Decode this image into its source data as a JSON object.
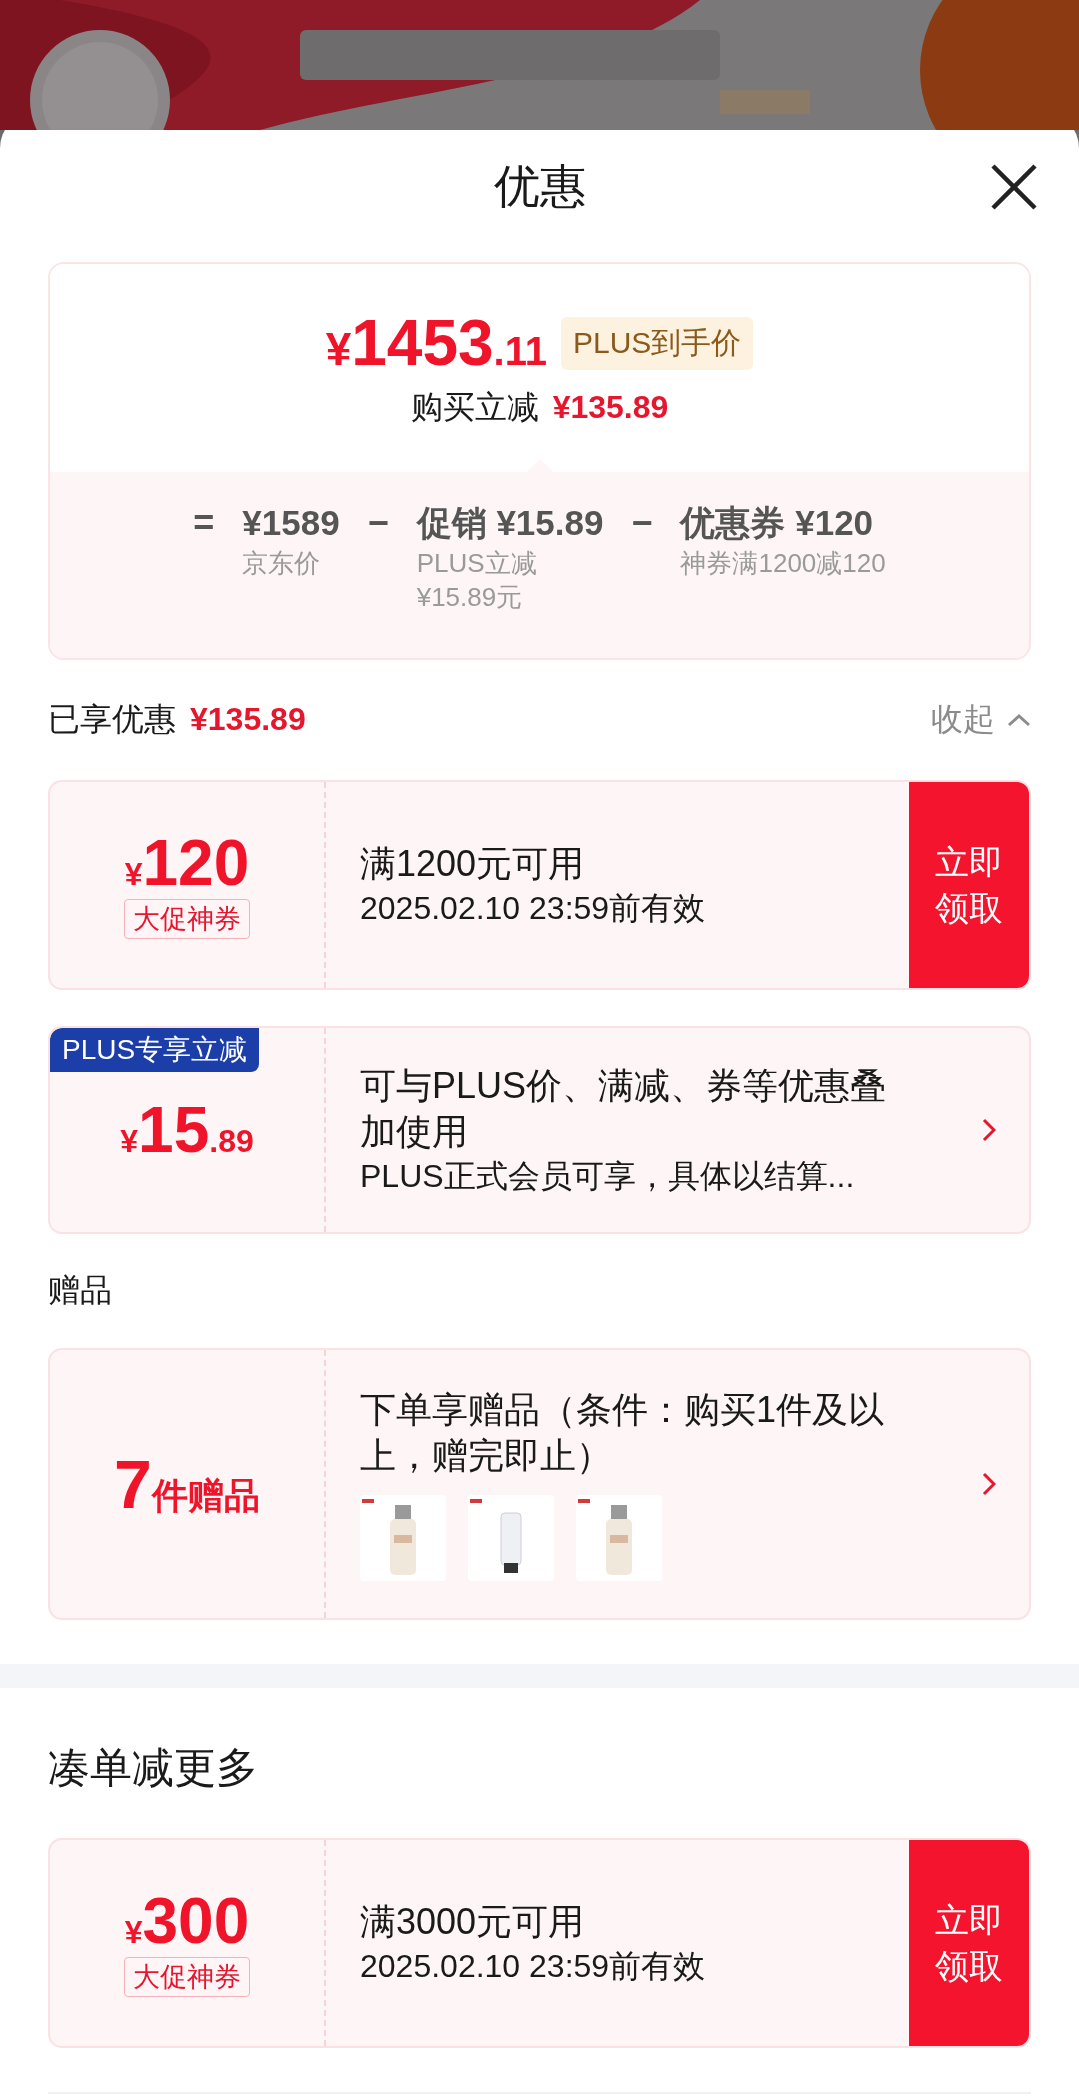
{
  "sheet": {
    "title": "优惠"
  },
  "summary": {
    "price_currency": "¥",
    "price_main": "1453",
    "price_fraction": ".11",
    "price_badge": "PLUS到手价",
    "instant_label": "购买立减",
    "instant_amount": "¥135.89",
    "breakdown": [
      {
        "kind": "operator",
        "text": "="
      },
      {
        "kind": "term",
        "value": "¥1589",
        "note": "京东价"
      },
      {
        "kind": "operator",
        "text": "−"
      },
      {
        "kind": "term",
        "value": "促销 ¥15.89",
        "note": "PLUS立减 ¥15.89元"
      },
      {
        "kind": "operator",
        "text": "−"
      },
      {
        "kind": "term",
        "value": "优惠券 ¥120",
        "note": "神券满1200减120"
      }
    ]
  },
  "enjoyed": {
    "label": "已享优惠",
    "amount": "¥135.89",
    "toggle": "收起"
  },
  "offers": [
    {
      "kind": "coupon",
      "currency": "¥",
      "amount": "120",
      "tag": "大促神券",
      "title": "满1200元可用",
      "subtitle": "2025.02.10 23:59前有效",
      "button": "立即领取"
    },
    {
      "kind": "plus",
      "badge": "PLUS专享立减",
      "currency": "¥",
      "amount": "15",
      "fraction": ".89",
      "title": "可与PLUS价、满减、券等优惠叠加使用",
      "subtitle": "PLUS正式会员可享，具体以结算..."
    }
  ],
  "gifts_label": "赠品",
  "gifts": {
    "count": "7",
    "count_label": "件赠品",
    "title": "下单享赠品（条件：购买1件及以上，赠完即止）"
  },
  "more_section": {
    "title": "凑单减更多",
    "offers": [
      {
        "kind": "coupon",
        "currency": "¥",
        "amount": "300",
        "tag": "大促神券",
        "title": "满3000元可用",
        "subtitle": "2025.02.10 23:59前有效",
        "button": "立即领取"
      }
    ]
  }
}
